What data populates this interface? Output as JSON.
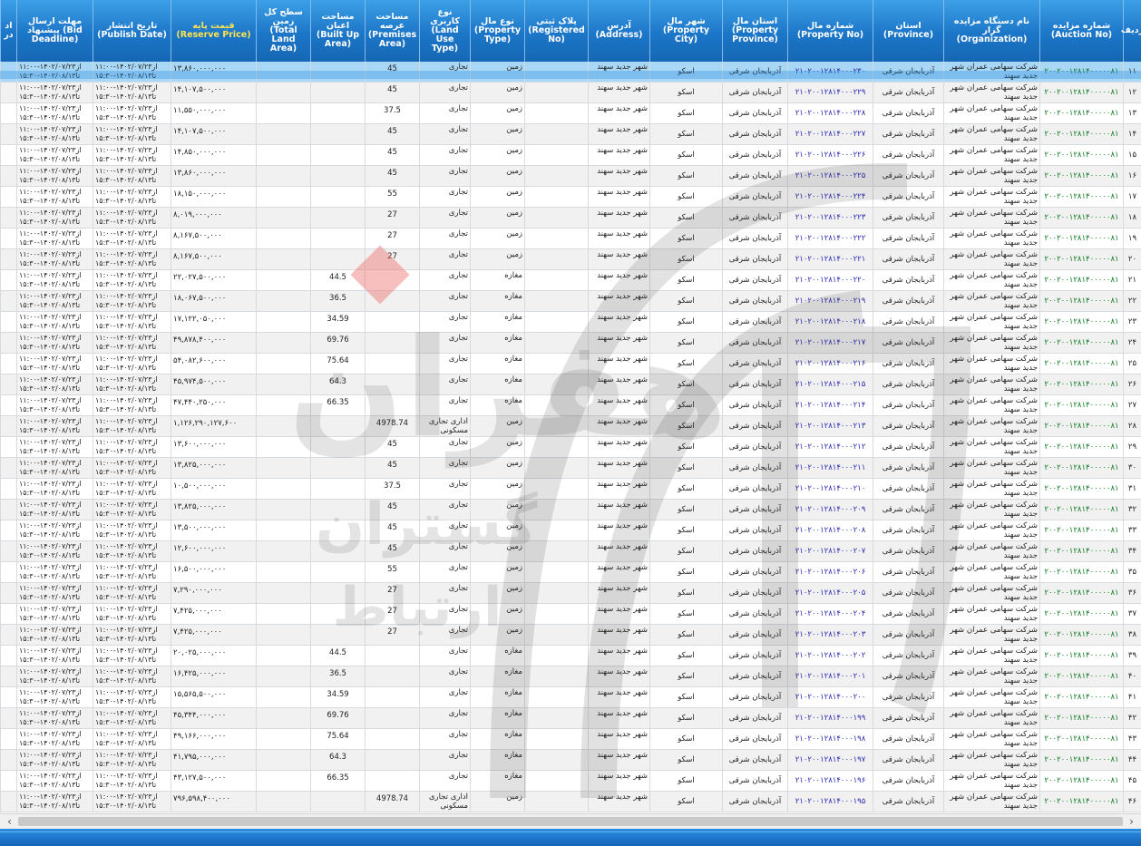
{
  "columns": [
    {
      "key": "row_no",
      "label": "ردیف"
    },
    {
      "key": "auction_no",
      "label": "شماره مزایده (Auction No)"
    },
    {
      "key": "organization",
      "label": "نام دستگاه مزایده گزار (Organization)"
    },
    {
      "key": "province",
      "label": "استان (Province)"
    },
    {
      "key": "property_no",
      "label": "شماره مال (Property No)"
    },
    {
      "key": "property_province",
      "label": "استان مال (Property Province)"
    },
    {
      "key": "property_city",
      "label": "شهر مال (Property City)"
    },
    {
      "key": "address",
      "label": "آدرس (Address)"
    },
    {
      "key": "registered_no",
      "label": "پلاک ثبتی (Registered No)"
    },
    {
      "key": "property_type",
      "label": "نوع مال (Property Type)"
    },
    {
      "key": "land_use",
      "label": "نوع کاربری (Land Use Type)"
    },
    {
      "key": "premises_area",
      "label": "مساحت عرصه (Premises Area)"
    },
    {
      "key": "built_area",
      "label": "مساحت اعیان (Built Up Area)"
    },
    {
      "key": "total_land_area",
      "label": "سطح کل زمین (Total Land Area)"
    },
    {
      "key": "reserve_price",
      "label": "قیمت پایه (Reserve Price)"
    },
    {
      "key": "publish_date",
      "label": "تاریخ انتشار (Publish Date)"
    },
    {
      "key": "bid_deadline",
      "label": "مهلت ارسال پیشنهاد (Bid Deadline)"
    },
    {
      "key": "extra",
      "label": "اد در"
    }
  ],
  "common": {
    "auction_no": "۲۰۰۲۰۰۱۲۸۱۴۰۰۰۰۰۸۱",
    "organization": "شرکت سهامی عمران شهر جدید سهند",
    "province": "آذربایجان شرقی",
    "property_province": "آذربایجان شرقی",
    "property_city": "اسکو",
    "address": "شهر جدید سهند",
    "registered_no": "",
    "publish_date": "از۱۴۰۲/۰۷/۲۳-۱۱:۰۰ تا۱۴۰۲/۰۸/۱۳-۱۵:۳۰",
    "bid_deadline": "از۱۴۰۲/۰۷/۲۳-۱۱:۰۰ تا۱۴۰۲/۰۸/۱۳-۱۵:۳۰"
  },
  "rows": [
    {
      "no": "۱۱",
      "pno": "۲۱۰۲۰۰۱۲۸۱۴۰۰۰۲۳۰",
      "type": "زمین",
      "use": "تجاری",
      "premises": "45",
      "built": "",
      "price": "۱۳,۸۶۰,۰۰۰,۰۰۰"
    },
    {
      "no": "۱۲",
      "pno": "۲۱۰۲۰۰۱۲۸۱۴۰۰۰۲۲۹",
      "type": "زمین",
      "use": "تجاری",
      "premises": "45",
      "built": "",
      "price": "۱۴,۱۰۷,۵۰۰,۰۰۰"
    },
    {
      "no": "۱۳",
      "pno": "۲۱۰۲۰۰۱۲۸۱۴۰۰۰۲۲۸",
      "type": "زمین",
      "use": "تجاری",
      "premises": "37.5",
      "built": "",
      "price": "۱۱,۵۵۰,۰۰۰,۰۰۰"
    },
    {
      "no": "۱۴",
      "pno": "۲۱۰۲۰۰۱۲۸۱۴۰۰۰۲۲۷",
      "type": "زمین",
      "use": "تجاری",
      "premises": "45",
      "built": "",
      "price": "۱۴,۱۰۷,۵۰۰,۰۰۰"
    },
    {
      "no": "۱۵",
      "pno": "۲۱۰۲۰۰۱۲۸۱۴۰۰۰۲۲۶",
      "type": "زمین",
      "use": "تجاری",
      "premises": "45",
      "built": "",
      "price": "۱۴,۸۵۰,۰۰۰,۰۰۰"
    },
    {
      "no": "۱۶",
      "pno": "۲۱۰۲۰۰۱۲۸۱۴۰۰۰۲۲۵",
      "type": "زمین",
      "use": "تجاری",
      "premises": "45",
      "built": "",
      "price": "۱۳,۸۶۰,۰۰۰,۰۰۰"
    },
    {
      "no": "۱۷",
      "pno": "۲۱۰۲۰۰۱۲۸۱۴۰۰۰۲۲۴",
      "type": "زمین",
      "use": "تجاری",
      "premises": "55",
      "built": "",
      "price": "۱۸,۱۵۰,۰۰۰,۰۰۰"
    },
    {
      "no": "۱۸",
      "pno": "۲۱۰۲۰۰۱۲۸۱۴۰۰۰۲۲۳",
      "type": "زمین",
      "use": "تجاری",
      "premises": "27",
      "built": "",
      "price": "۸,۰۱۹,۰۰۰,۰۰۰"
    },
    {
      "no": "۱۹",
      "pno": "۲۱۰۲۰۰۱۲۸۱۴۰۰۰۲۲۲",
      "type": "زمین",
      "use": "تجاری",
      "premises": "27",
      "built": "",
      "price": "۸,۱۶۷,۵۰۰,۰۰۰"
    },
    {
      "no": "۲۰",
      "pno": "۲۱۰۲۰۰۱۲۸۱۴۰۰۰۲۲۱",
      "type": "زمین",
      "use": "تجاری",
      "premises": "27",
      "built": "",
      "price": "۸,۱۶۷,۵۰۰,۰۰۰"
    },
    {
      "no": "۲۱",
      "pno": "۲۱۰۲۰۰۱۲۸۱۴۰۰۰۲۲۰",
      "type": "مغازه",
      "use": "تجاری",
      "premises": "",
      "built": "44.5",
      "price": "۲۲,۰۲۷,۵۰۰,۰۰۰"
    },
    {
      "no": "۲۲",
      "pno": "۲۱۰۲۰۰۱۲۸۱۴۰۰۰۲۱۹",
      "type": "مغازه",
      "use": "تجاری",
      "premises": "",
      "built": "36.5",
      "price": "۱۸,۰۶۷,۵۰۰,۰۰۰"
    },
    {
      "no": "۲۳",
      "pno": "۲۱۰۲۰۰۱۲۸۱۴۰۰۰۲۱۸",
      "type": "مغازه",
      "use": "تجاری",
      "premises": "",
      "built": "34.59",
      "price": "۱۷,۱۲۲,۰۵۰,۰۰۰"
    },
    {
      "no": "۲۴",
      "pno": "۲۱۰۲۰۰۱۲۸۱۴۰۰۰۲۱۷",
      "type": "مغازه",
      "use": "تجاری",
      "premises": "",
      "built": "69.76",
      "price": "۴۹,۸۷۸,۴۰۰,۰۰۰"
    },
    {
      "no": "۲۵",
      "pno": "۲۱۰۲۰۰۱۲۸۱۴۰۰۰۲۱۶",
      "type": "مغازه",
      "use": "تجاری",
      "premises": "",
      "built": "75.64",
      "price": "۵۴,۰۸۲,۶۰۰,۰۰۰"
    },
    {
      "no": "۲۶",
      "pno": "۲۱۰۲۰۰۱۲۸۱۴۰۰۰۲۱۵",
      "type": "مغازه",
      "use": "تجاری",
      "premises": "",
      "built": "64.3",
      "price": "۴۵,۹۷۴,۵۰۰,۰۰۰"
    },
    {
      "no": "۲۷",
      "pno": "۲۱۰۲۰۰۱۲۸۱۴۰۰۰۲۱۴",
      "type": "مغازه",
      "use": "تجاری",
      "premises": "",
      "built": "66.35",
      "price": "۴۷,۴۴۰,۲۵۰,۰۰۰"
    },
    {
      "no": "۲۸",
      "pno": "۲۱۰۲۰۰۱۲۸۱۴۰۰۰۲۱۳",
      "type": "زمین",
      "use": "اداری تجاری مسکونی",
      "premises": "4978.74",
      "built": "",
      "price": "۱,۱۲۶,۲۹۰,۱۲۷,۶۰۰"
    },
    {
      "no": "۲۹",
      "pno": "۲۱۰۲۰۰۱۲۸۱۴۰۰۰۲۱۲",
      "type": "زمین",
      "use": "تجاری",
      "premises": "45",
      "built": "",
      "price": "۱۳,۶۰۰,۰۰۰,۰۰۰"
    },
    {
      "no": "۳۰",
      "pno": "۲۱۰۲۰۰۱۲۸۱۴۰۰۰۲۱۱",
      "type": "زمین",
      "use": "تجاری",
      "premises": "45",
      "built": "",
      "price": "۱۳,۸۲۵,۰۰۰,۰۰۰"
    },
    {
      "no": "۳۱",
      "pno": "۲۱۰۲۰۰۱۲۸۱۴۰۰۰۲۱۰",
      "type": "زمین",
      "use": "تجاری",
      "premises": "37.5",
      "built": "",
      "price": "۱۰,۵۰۰,۰۰۰,۰۰۰"
    },
    {
      "no": "۳۲",
      "pno": "۲۱۰۲۰۰۱۲۸۱۴۰۰۰۲۰۹",
      "type": "زمین",
      "use": "تجاری",
      "premises": "45",
      "built": "",
      "price": "۱۳,۸۲۵,۰۰۰,۰۰۰"
    },
    {
      "no": "۳۳",
      "pno": "۲۱۰۲۰۰۱۲۸۱۴۰۰۰۲۰۸",
      "type": "زمین",
      "use": "تجاری",
      "premises": "45",
      "built": "",
      "price": "۱۳,۵۰۰,۰۰۰,۰۰۰"
    },
    {
      "no": "۳۴",
      "pno": "۲۱۰۲۰۰۱۲۸۱۴۰۰۰۲۰۷",
      "type": "زمین",
      "use": "تجاری",
      "premises": "45",
      "built": "",
      "price": "۱۲,۶۰۰,۰۰۰,۰۰۰"
    },
    {
      "no": "۳۵",
      "pno": "۲۱۰۲۰۰۱۲۸۱۴۰۰۰۲۰۶",
      "type": "زمین",
      "use": "تجاری",
      "premises": "55",
      "built": "",
      "price": "۱۶,۵۰۰,۰۰۰,۰۰۰"
    },
    {
      "no": "۳۶",
      "pno": "۲۱۰۲۰۰۱۲۸۱۴۰۰۰۲۰۵",
      "type": "زمین",
      "use": "تجاری",
      "premises": "27",
      "built": "",
      "price": "۷,۲۹۰,۰۰۰,۰۰۰"
    },
    {
      "no": "۳۷",
      "pno": "۲۱۰۲۰۰۱۲۸۱۴۰۰۰۲۰۴",
      "type": "زمین",
      "use": "تجاری",
      "premises": "27",
      "built": "",
      "price": "۷,۴۲۵,۰۰۰,۰۰۰"
    },
    {
      "no": "۳۸",
      "pno": "۲۱۰۲۰۰۱۲۸۱۴۰۰۰۲۰۳",
      "type": "زمین",
      "use": "تجاری",
      "premises": "27",
      "built": "",
      "price": "۷,۴۲۵,۰۰۰,۰۰۰"
    },
    {
      "no": "۳۹",
      "pno": "۲۱۰۲۰۰۱۲۸۱۴۰۰۰۲۰۲",
      "type": "مغازه",
      "use": "تجاری",
      "premises": "",
      "built": "44.5",
      "price": "۲۰,۰۲۵,۰۰۰,۰۰۰"
    },
    {
      "no": "۴۰",
      "pno": "۲۱۰۲۰۰۱۲۸۱۴۰۰۰۲۰۱",
      "type": "مغازه",
      "use": "تجاری",
      "premises": "",
      "built": "36.5",
      "price": "۱۶,۴۲۵,۰۰۰,۰۰۰"
    },
    {
      "no": "۴۱",
      "pno": "۲۱۰۲۰۰۱۲۸۱۴۰۰۰۲۰۰",
      "type": "مغازه",
      "use": "تجاری",
      "premises": "",
      "built": "34.59",
      "price": "۱۵,۵۶۵,۵۰۰,۰۰۰"
    },
    {
      "no": "۴۲",
      "pno": "۲۱۰۲۰۰۱۲۸۱۴۰۰۰۱۹۹",
      "type": "مغازه",
      "use": "تجاری",
      "premises": "",
      "built": "69.76",
      "price": "۴۵,۳۴۴,۰۰۰,۰۰۰"
    },
    {
      "no": "۴۳",
      "pno": "۲۱۰۲۰۰۱۲۸۱۴۰۰۰۱۹۸",
      "type": "مغازه",
      "use": "تجاری",
      "premises": "",
      "built": "75.64",
      "price": "۴۹,۱۶۶,۰۰۰,۰۰۰"
    },
    {
      "no": "۴۴",
      "pno": "۲۱۰۲۰۰۱۲۸۱۴۰۰۰۱۹۷",
      "type": "مغازه",
      "use": "تجاری",
      "premises": "",
      "built": "64.3",
      "price": "۴۱,۷۹۵,۰۰۰,۰۰۰"
    },
    {
      "no": "۴۵",
      "pno": "۲۱۰۲۰۰۱۲۸۱۴۰۰۰۱۹۶",
      "type": "مغازه",
      "use": "تجاری",
      "premises": "",
      "built": "66.35",
      "price": "۴۳,۱۲۷,۵۰۰,۰۰۰"
    },
    {
      "no": "۴۶",
      "pno": "۲۱۰۲۰۰۱۲۸۱۴۰۰۰۱۹۵",
      "type": "زمین",
      "use": "اداری تجاری مسکونی",
      "premises": "4978.74",
      "built": "",
      "price": "۷۹۶,۵۹۸,۴۰۰,۰۰۰"
    }
  ],
  "selected_row_no": "۱۱",
  "colors": {
    "header_top": "#3da0e6",
    "header_bottom": "#1667b4",
    "reserve_price_header": "#ffe34d",
    "selected_row": "#a9d8f6",
    "auction_no_text": "#107a23",
    "property_no_text": "#2a2ab0"
  },
  "scrollbar": {
    "left_arrow": "‹",
    "right_arrow": "›"
  }
}
